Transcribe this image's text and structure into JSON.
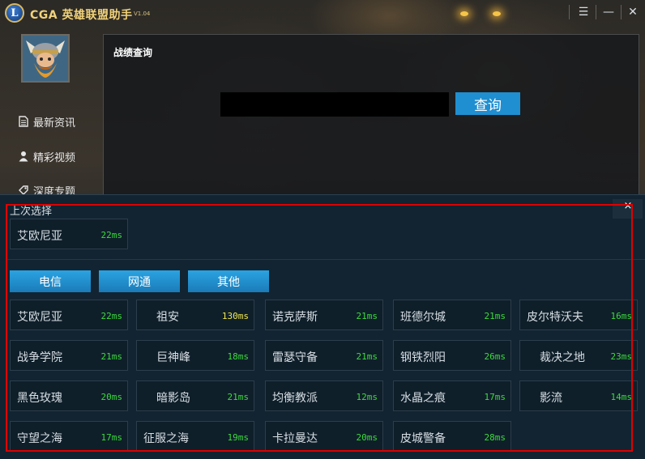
{
  "app": {
    "logo_letter": "L",
    "title": "CGA 英雄联盟助手",
    "version": "V1.04",
    "window_buttons": {
      "menu": "☰",
      "minimize": "—",
      "close": "✕"
    }
  },
  "sidebar": {
    "items": [
      {
        "label": "最新资讯",
        "icon": "document-icon"
      },
      {
        "label": "精彩视频",
        "icon": "user-icon"
      },
      {
        "label": "深度专题",
        "icon": "tag-icon"
      }
    ]
  },
  "match_query": {
    "title": "战绩查询",
    "input_value": "",
    "button_label": "查询"
  },
  "server_select": {
    "title": "上次选择",
    "close_label": "×",
    "last": {
      "name": "艾欧尼亚",
      "ping": "22ms"
    },
    "tabs": [
      "电信",
      "网通",
      "其他"
    ],
    "servers": [
      {
        "name": "艾欧尼亚",
        "ping": "22ms"
      },
      {
        "name": "祖安",
        "ping": "130ms"
      },
      {
        "name": "诺克萨斯",
        "ping": "21ms"
      },
      {
        "name": "班德尔城",
        "ping": "21ms"
      },
      {
        "name": "皮尔特沃夫",
        "ping": "16ms"
      },
      {
        "name": "战争学院",
        "ping": "21ms"
      },
      {
        "name": "巨神峰",
        "ping": "18ms"
      },
      {
        "name": "雷瑟守备",
        "ping": "21ms"
      },
      {
        "name": "钢铁烈阳",
        "ping": "26ms"
      },
      {
        "name": "裁决之地",
        "ping": "23ms"
      },
      {
        "name": "黑色玫瑰",
        "ping": "20ms"
      },
      {
        "name": "暗影岛",
        "ping": "21ms"
      },
      {
        "name": "均衡教派",
        "ping": "12ms"
      },
      {
        "name": "水晶之痕",
        "ping": "17ms"
      },
      {
        "name": "影流",
        "ping": "14ms"
      },
      {
        "name": "守望之海",
        "ping": "17ms"
      },
      {
        "name": "征服之海",
        "ping": "19ms"
      },
      {
        "name": "卡拉曼达",
        "ping": "20ms"
      },
      {
        "name": "皮城警备",
        "ping": "28ms"
      }
    ]
  },
  "colors": {
    "accent": "#1f8fd1",
    "ping_good": "#3bdc3b",
    "ping_high": "#f1e84a",
    "highlight_frame": "#e00000"
  }
}
